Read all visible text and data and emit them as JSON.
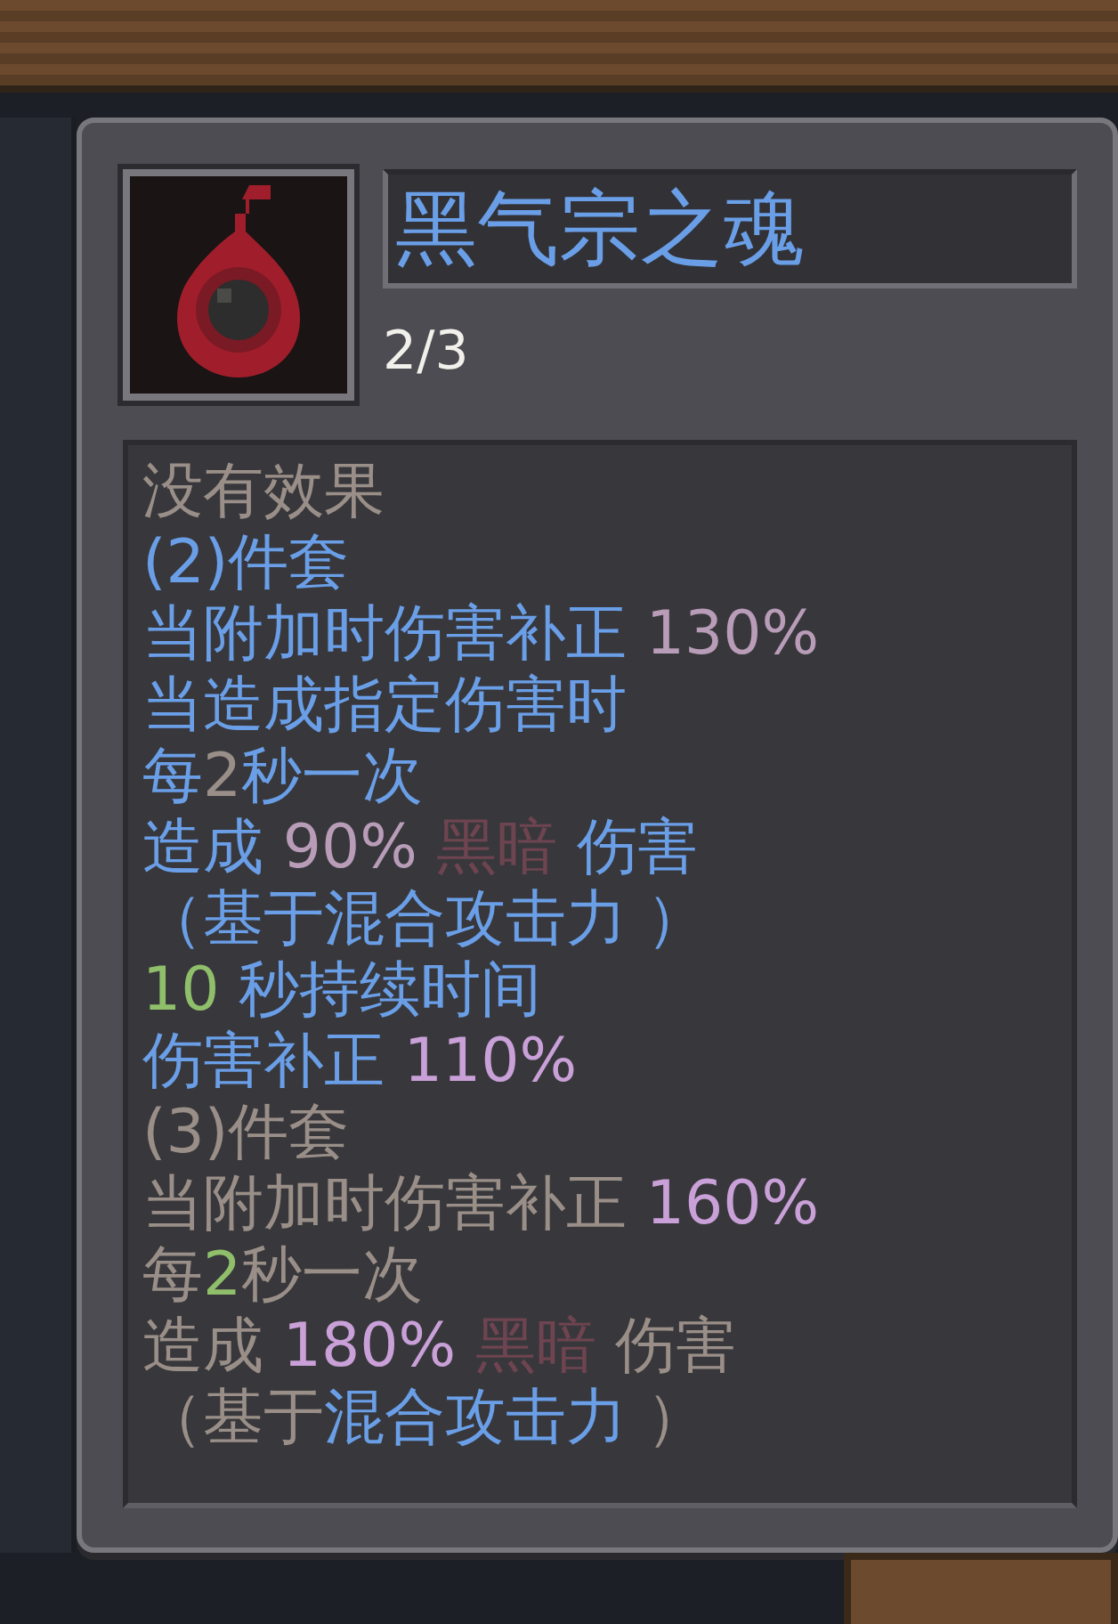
{
  "item": {
    "name": "黑气宗之魂",
    "count": "2/3"
  },
  "lines": [
    {
      "segments": [
        {
          "text": "没有效果",
          "color": "#9a8f88"
        }
      ]
    },
    {
      "segments": [
        {
          "text": "(2)件套",
          "color": "#6a9fe8"
        }
      ]
    },
    {
      "segments": [
        {
          "text": "当附加时伤害补正 ",
          "color": "#6a9fe8"
        },
        {
          "text": "130%",
          "color": "#b89cb8"
        }
      ]
    },
    {
      "segments": [
        {
          "text": "当造成指定伤害时",
          "color": "#6a9fe8"
        }
      ]
    },
    {
      "segments": [
        {
          "text": "每",
          "color": "#6a9fe8"
        },
        {
          "text": "2",
          "color": "#9a8f88"
        },
        {
          "text": "秒一次",
          "color": "#6a9fe8"
        }
      ]
    },
    {
      "segments": [
        {
          "text": "造成 ",
          "color": "#6a9fe8"
        },
        {
          "text": "90% ",
          "color": "#b89cb8"
        },
        {
          "text": "黑暗",
          "color": "#6e4450"
        },
        {
          "text": " 伤害",
          "color": "#6a9fe8"
        }
      ]
    },
    {
      "segments": [
        {
          "text": "（基于混合攻击力 ）",
          "color": "#6a9fe8"
        }
      ]
    },
    {
      "segments": [
        {
          "text": "10",
          "color": "#8fbf6a"
        },
        {
          "text": " 秒持续时间",
          "color": "#6a9fe8"
        }
      ]
    },
    {
      "segments": [
        {
          "text": "伤害补正 ",
          "color": "#6a9fe8"
        },
        {
          "text": "110%",
          "color": "#c9a0d8"
        }
      ]
    },
    {
      "segments": [
        {
          "text": "(3)件套",
          "color": "#9a8f88"
        }
      ]
    },
    {
      "segments": [
        {
          "text": "当附加时伤害补正 ",
          "color": "#9a8f88"
        },
        {
          "text": "160%",
          "color": "#c9a0d8"
        }
      ]
    },
    {
      "segments": [
        {
          "text": "每",
          "color": "#9a8f88"
        },
        {
          "text": "2",
          "color": "#8fbf6a"
        },
        {
          "text": "秒一次",
          "color": "#9a8f88"
        }
      ]
    },
    {
      "segments": [
        {
          "text": "造成 ",
          "color": "#9a8f88"
        },
        {
          "text": "180% ",
          "color": "#c9a0d8"
        },
        {
          "text": "黑暗",
          "color": "#6e4450"
        },
        {
          "text": " 伤害",
          "color": "#9a8f88"
        }
      ]
    },
    {
      "segments": [
        {
          "text": "（基于",
          "color": "#9a8f88"
        },
        {
          "text": "混合攻击力",
          "color": "#6a9fe8"
        },
        {
          "text": " ）",
          "color": "#9a8f88"
        }
      ]
    }
  ]
}
